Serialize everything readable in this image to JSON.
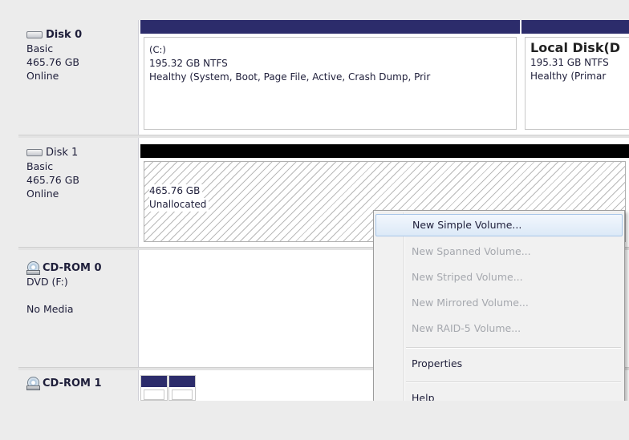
{
  "disks": [
    {
      "name": "Disk 0",
      "type": "Basic",
      "size": "465.76 GB",
      "status": "Online",
      "icon": "hard-drive-icon",
      "volumes": [
        {
          "name": "(C:)",
          "detail": "195.32 GB NTFS",
          "health": "Healthy (System, Boot, Page File, Active, Crash Dump, Prir"
        },
        {
          "name": "Local Disk(D",
          "detail": "195.31 GB NTFS",
          "health": "Healthy (Primar"
        }
      ]
    },
    {
      "name": "Disk 1",
      "type": "Basic",
      "size": "465.76 GB",
      "status": "Online",
      "icon": "hard-drive-icon",
      "volumes": [
        {
          "detail": "465.76 GB",
          "health": "Unallocated"
        }
      ]
    },
    {
      "name": "CD-ROM 0",
      "type": "DVD (F:)",
      "status": "No Media",
      "icon": "cd-drive-icon"
    },
    {
      "name": "CD-ROM 1",
      "icon": "cd-drive-icon"
    }
  ],
  "context_menu": {
    "items": [
      {
        "label": "New Simple Volume...",
        "enabled": true,
        "highlighted": true
      },
      {
        "label": "New Spanned Volume...",
        "enabled": false
      },
      {
        "label": "New Striped Volume...",
        "enabled": false
      },
      {
        "label": "New Mirrored Volume...",
        "enabled": false
      },
      {
        "label": "New RAID-5 Volume...",
        "enabled": false
      },
      {
        "label": "Properties",
        "enabled": true
      },
      {
        "label": "Help",
        "enabled": true
      }
    ]
  },
  "colors": {
    "primary_partition_bar": "#2c2c6b",
    "unallocated_bar": "#000000",
    "menu_highlight": "#dce9f7"
  }
}
